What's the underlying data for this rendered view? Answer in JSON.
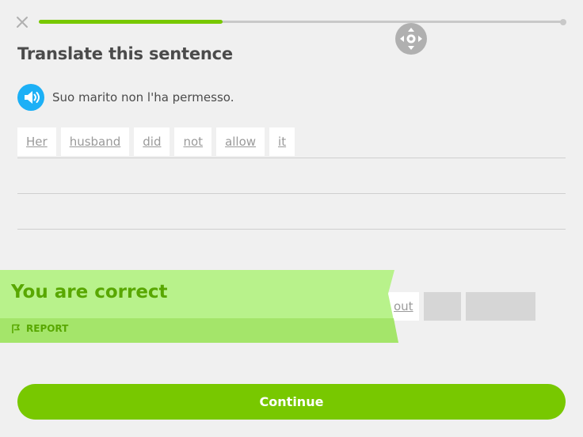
{
  "header": {
    "close_icon": "close-icon",
    "progress": 0.35
  },
  "exercise": {
    "title": "Translate this sentence",
    "speaker_icon": "speaker-icon",
    "prompt": "Suo marito non l'ha permesso.",
    "answer_tiles": [
      "Her",
      "husband",
      "did",
      "not",
      "allow",
      "it"
    ]
  },
  "word_bank": {
    "visible_tile": "out"
  },
  "feedback": {
    "message": "You are correct",
    "report_label": "REPORT",
    "report_icon": "flag-icon"
  },
  "footer": {
    "continue_label": "Continue"
  },
  "colors": {
    "accent_green": "#78c800",
    "feedback_green": "#58a700",
    "banner_bg": "#b8f28b",
    "speaker_blue": "#1cb0f6"
  }
}
